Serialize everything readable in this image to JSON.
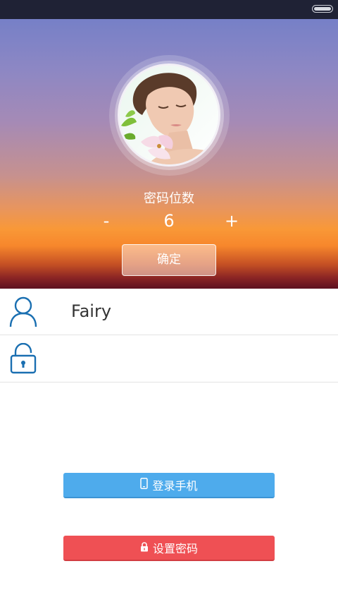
{
  "status_bar": {
    "battery_icon": "battery-full-icon"
  },
  "hero": {
    "avatar_icon": "avatar-photo",
    "password_length_label": "密码位数",
    "decrement_label": "-",
    "password_length_value": "6",
    "increment_label": "+",
    "confirm_label": "确定"
  },
  "form": {
    "user_icon": "user-icon",
    "username": "Fairy",
    "lock_icon": "lock-open-icon",
    "password_value": ""
  },
  "actions": {
    "login_phone_label": "登录手机",
    "login_phone_icon": "phone-icon",
    "set_password_label": "设置密码",
    "set_password_icon": "lock-icon"
  },
  "colors": {
    "status_bar": "#1f2235",
    "accent_blue": "#4eabec",
    "accent_red": "#ef5054",
    "icon_blue": "#1a6fb1"
  }
}
